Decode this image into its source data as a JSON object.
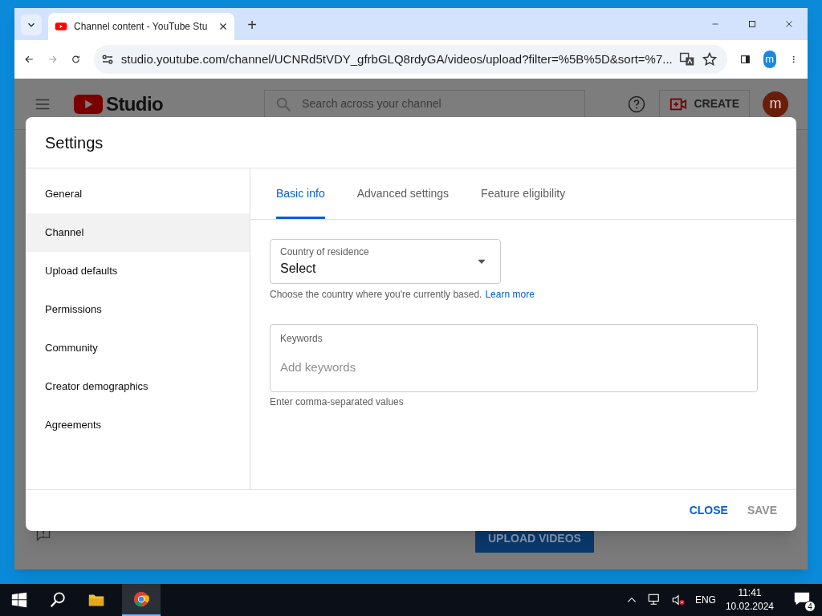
{
  "browser": {
    "tab_title": "Channel content - YouTube Stu",
    "new_tab": "+",
    "url": "studio.youtube.com/channel/UCNRd5tVDY_gfrbGLQ8rdyGA/videos/upload?filter=%5B%5D&sort=%7...",
    "profile": "m"
  },
  "studio": {
    "logo": "Studio",
    "search_placeholder": "Search across your channel",
    "create": "CREATE",
    "avatar": "m",
    "upload": "UPLOAD VIDEOS"
  },
  "dialog": {
    "title": "Settings",
    "nav": [
      {
        "label": "General",
        "selected": false
      },
      {
        "label": "Channel",
        "selected": true
      },
      {
        "label": "Upload defaults",
        "selected": false
      },
      {
        "label": "Permissions",
        "selected": false
      },
      {
        "label": "Community",
        "selected": false
      },
      {
        "label": "Creator demographics",
        "selected": false
      },
      {
        "label": "Agreements",
        "selected": false
      }
    ],
    "tabs": [
      {
        "label": "Basic info",
        "selected": true
      },
      {
        "label": "Advanced settings",
        "selected": false
      },
      {
        "label": "Feature eligibility",
        "selected": false
      }
    ],
    "country": {
      "label": "Country of residence",
      "value": "Select",
      "help": "Choose the country where you're currently based.",
      "link": "Learn more"
    },
    "keywords": {
      "label": "Keywords",
      "placeholder": "Add keywords",
      "help": "Enter comma-separated values"
    },
    "buttons": [
      {
        "label": "CLOSE",
        "disabled": false
      },
      {
        "label": "SAVE",
        "disabled": true
      }
    ]
  },
  "taskbar": {
    "lang": "ENG",
    "time": "11:41",
    "date": "10.02.2024",
    "notifications": "4"
  }
}
